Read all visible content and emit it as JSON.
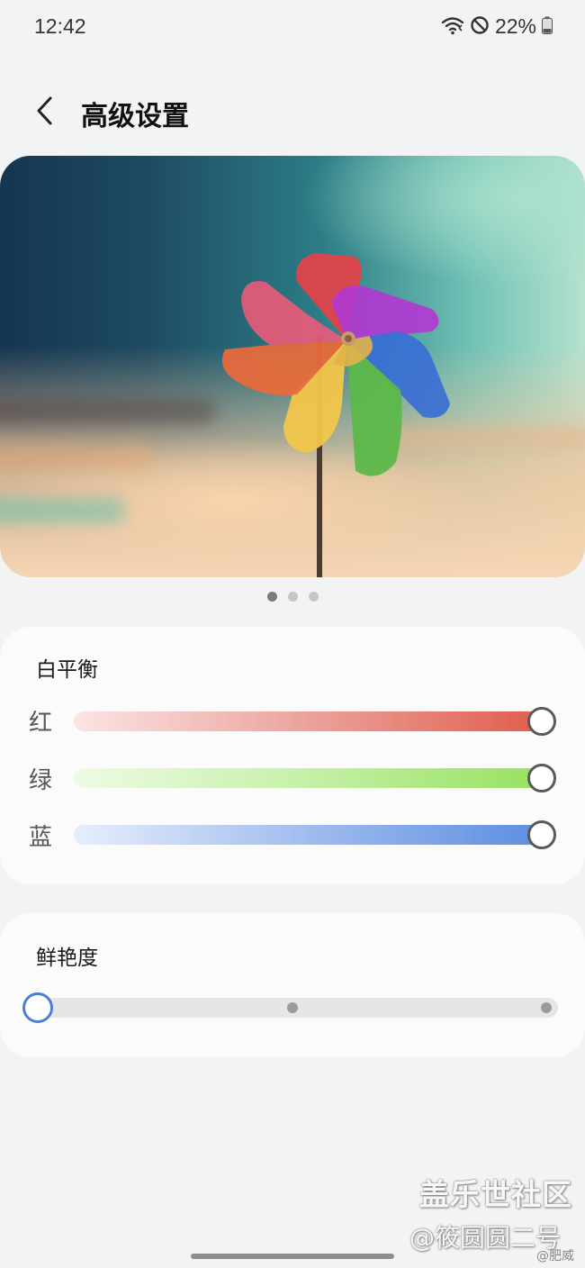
{
  "status_bar": {
    "time": "12:42",
    "battery": "22%",
    "icons": [
      "wifi-icon",
      "do-not-disturb-icon",
      "battery-icon"
    ]
  },
  "header": {
    "title": "高级设置",
    "back_icon": "chevron-left-icon"
  },
  "preview": {
    "page_count": 3,
    "active_page": 1
  },
  "white_balance": {
    "title": "白平衡",
    "sliders": [
      {
        "label": "红",
        "value": 1.0,
        "color": "#e05a4a"
      },
      {
        "label": "绿",
        "value": 1.0,
        "color": "#96e05e"
      },
      {
        "label": "蓝",
        "value": 1.0,
        "color": "#5a8ce0"
      }
    ]
  },
  "saturation": {
    "title": "鲜艳度",
    "steps": 3,
    "selected_step": 0,
    "thumb_color": "#4a7fd6"
  },
  "watermark": {
    "main": "盖乐世社区",
    "sub": "@筱圆圆二号",
    "sub2": "@肥威"
  }
}
